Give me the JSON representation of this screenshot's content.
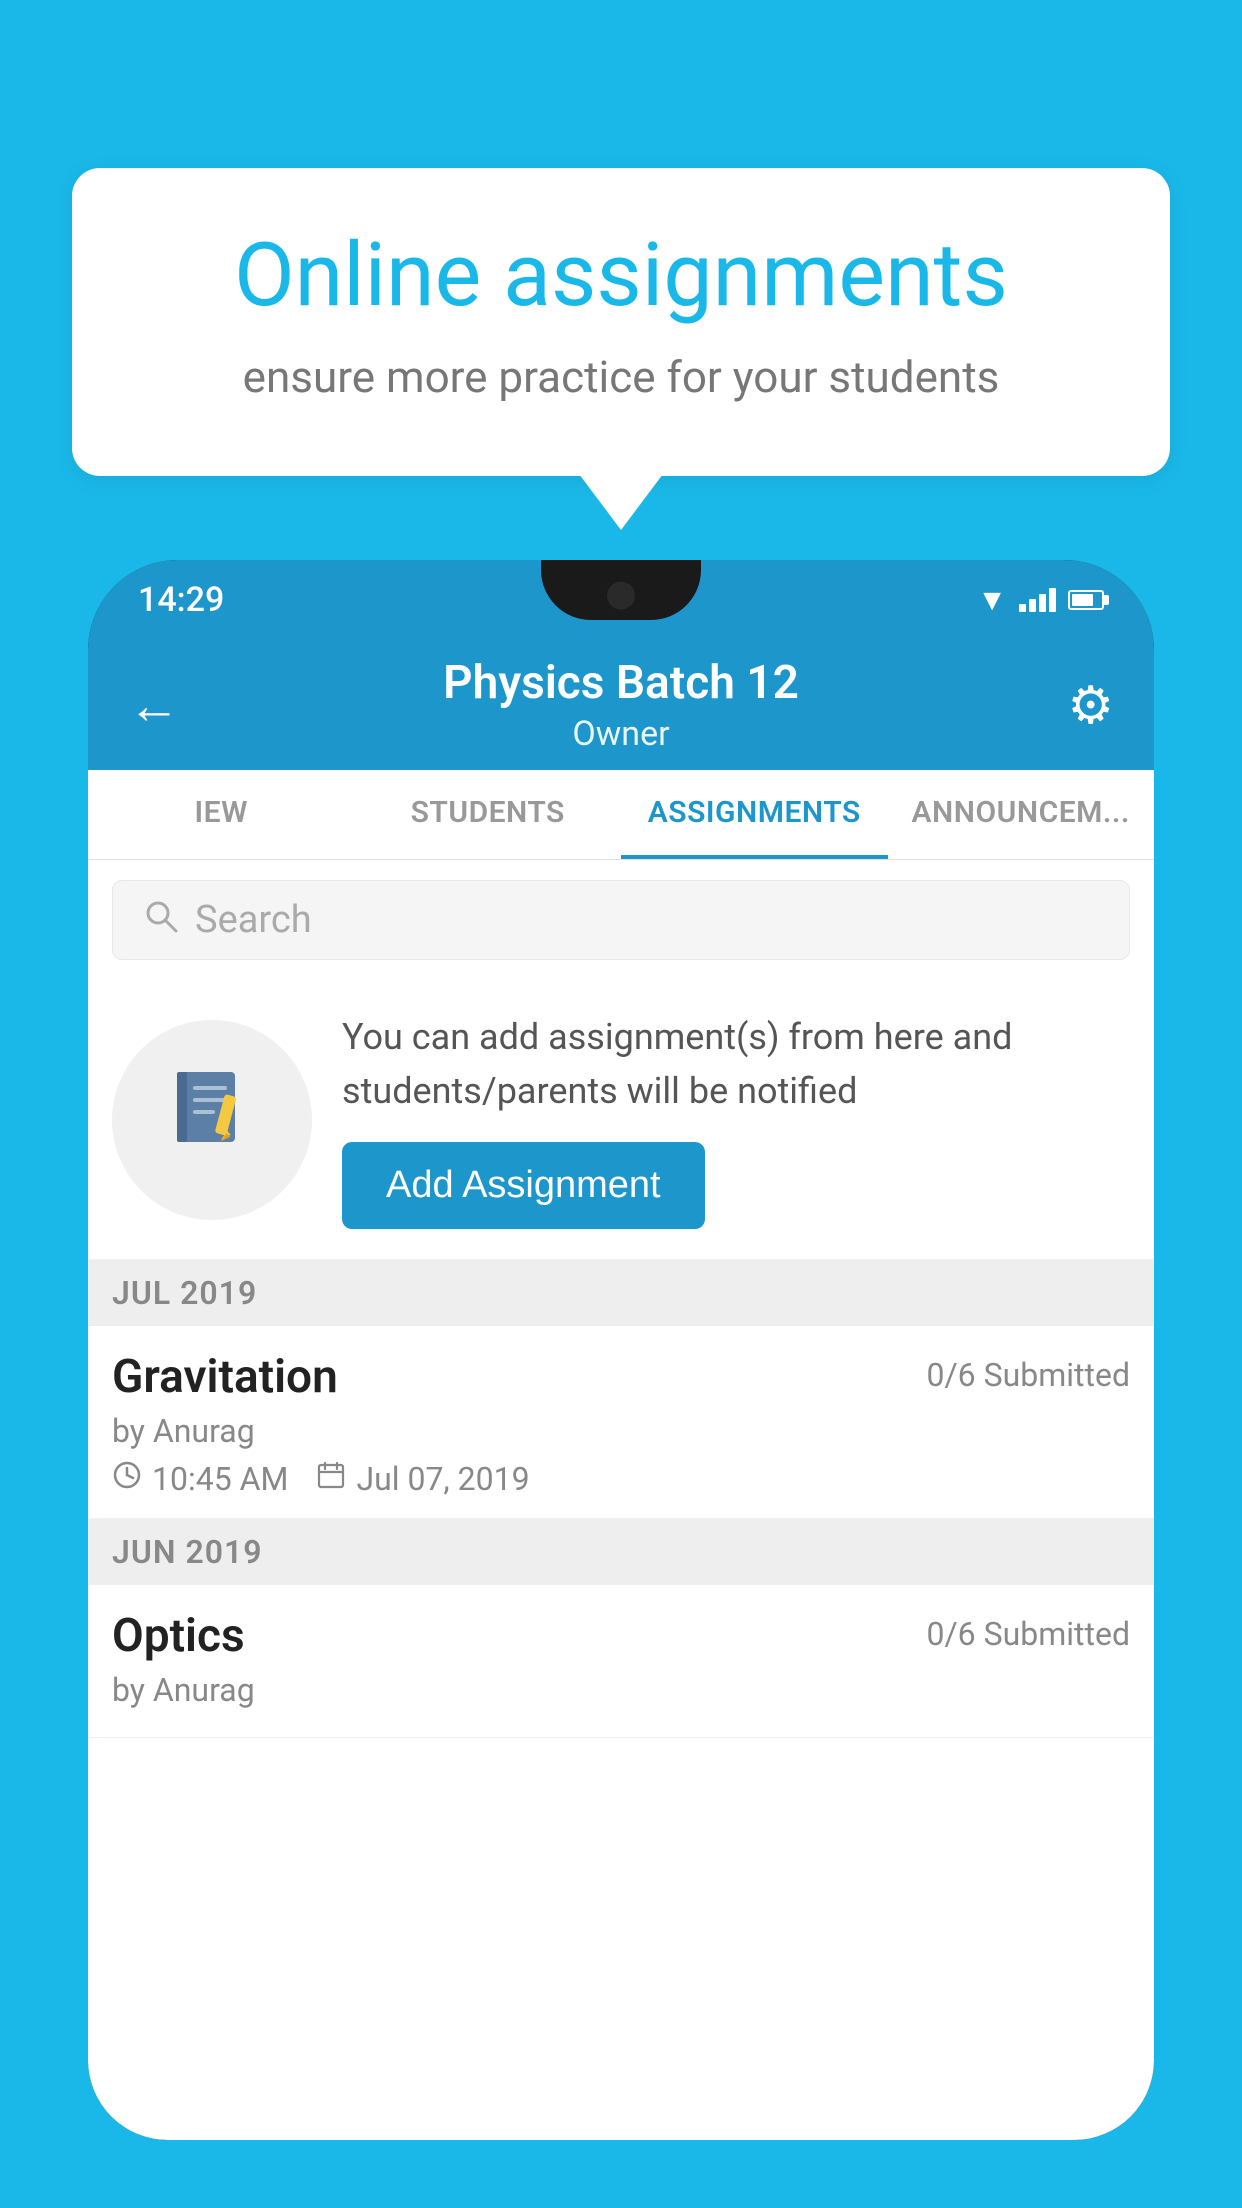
{
  "background": {
    "color": "#1ab8e8"
  },
  "speech_bubble": {
    "title": "Online assignments",
    "subtitle": "ensure more practice for your students"
  },
  "phone": {
    "status_bar": {
      "time": "14:29"
    },
    "header": {
      "title": "Physics Batch 12",
      "subtitle": "Owner",
      "back_label": "←",
      "settings_label": "⚙"
    },
    "tabs": [
      {
        "label": "IEW",
        "active": false
      },
      {
        "label": "STUDENTS",
        "active": false
      },
      {
        "label": "ASSIGNMENTS",
        "active": true
      },
      {
        "label": "ANNOUNCEM...",
        "active": false
      }
    ],
    "search": {
      "placeholder": "Search"
    },
    "promo": {
      "text": "You can add assignment(s) from here and students/parents will be notified",
      "button_label": "Add Assignment"
    },
    "assignments": [
      {
        "section": "JUL 2019",
        "items": [
          {
            "title": "Gravitation",
            "submitted": "0/6 Submitted",
            "by": "by Anurag",
            "time": "10:45 AM",
            "date": "Jul 07, 2019"
          }
        ]
      },
      {
        "section": "JUN 2019",
        "items": [
          {
            "title": "Optics",
            "submitted": "0/6 Submitted",
            "by": "by Anurag",
            "time": "",
            "date": ""
          }
        ]
      }
    ]
  }
}
